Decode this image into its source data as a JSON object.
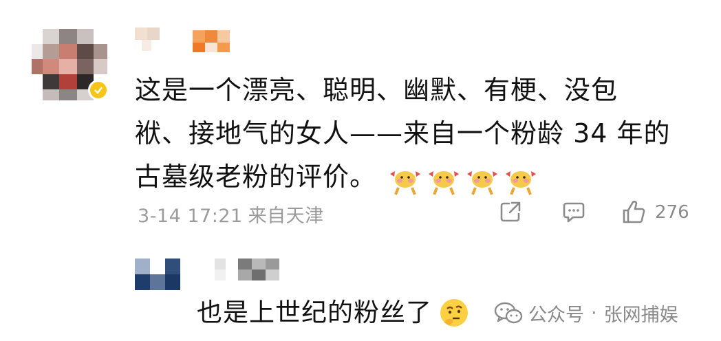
{
  "comment": {
    "text_line1": "这是一个漂亮、聪明、幽默、有梗、没包",
    "text_line2": "袱、接地气的女人——来自一个粉龄 34 年的",
    "text_line3": "古墓级老粉的评价。",
    "emoji_count": 4,
    "emoji_icon": "dancing-hamster-emoji",
    "timestamp": "3-14 17:21",
    "location": "来自天津",
    "like_count": "276"
  },
  "reply": {
    "text": "也是上世纪的粉丝了",
    "emoji_icon": "thinking-face-emoji"
  },
  "watermark": {
    "source": "公众号",
    "separator": "·",
    "author": "张网捕娱"
  },
  "colors": {
    "text": "#111111",
    "meta": "#9b9b9b",
    "verified": "#f5c518"
  }
}
